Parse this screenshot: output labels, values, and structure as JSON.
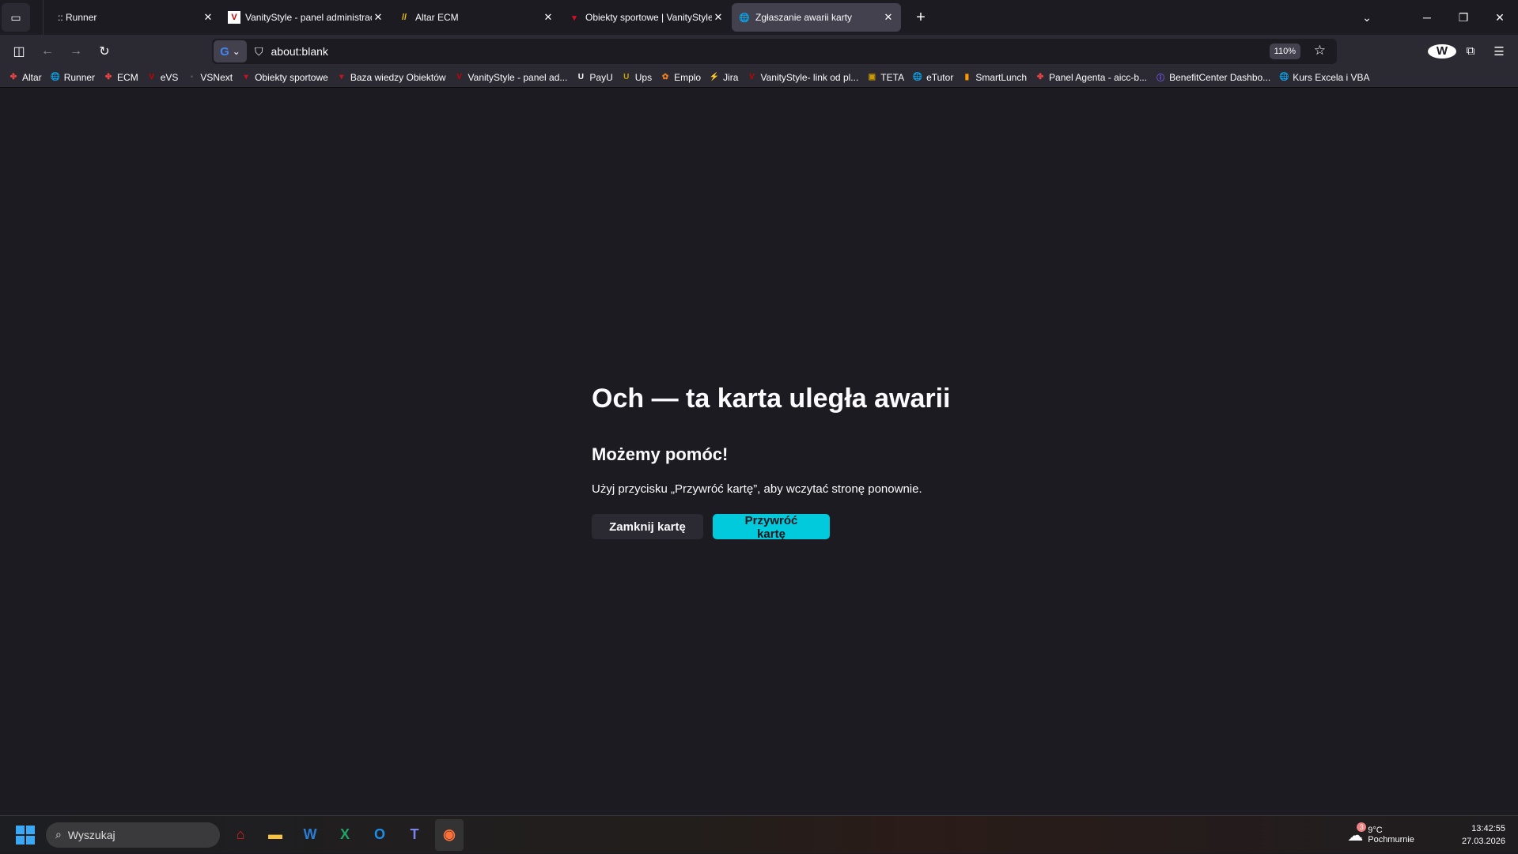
{
  "tabs": [
    {
      "title": ":: Runner",
      "icon": "none"
    },
    {
      "title": "VanityStyle - panel administracyjny",
      "icon": "vs-icon"
    },
    {
      "title": "Altar ECM",
      "icon": "altar-icon"
    },
    {
      "title": "Obiekty sportowe | VanityStyle.pl",
      "icon": "vanity-v-icon"
    },
    {
      "title": "Zgłaszanie awarii karty",
      "icon": "globe-alert-icon",
      "active": true
    }
  ],
  "url": "about:blank",
  "zoom": "110%",
  "bookmarks": [
    "Altar",
    "Runner",
    "ECM",
    "eVS",
    "VSNext",
    "Obiekty sportowe",
    "Baza wiedzy Obiektów",
    "VanityStyle - panel ad...",
    "PayU",
    "Ups",
    "Emplo",
    "Jira",
    "VanityStyle- link od pl...",
    "TETA",
    "eTutor",
    "SmartLunch",
    "Panel Agenta - aicc-b...",
    "BenefitCenter Dashbo...",
    "Kurs Excela i VBA"
  ],
  "page": {
    "heading": "Och — ta karta uległa awarii",
    "subheading": "Możemy pomóc!",
    "message": "Użyj przycisku „Przywróć kartę”, aby wczytać stronę ponownie.",
    "close_button": "Zamknij kartę",
    "restore_button": "Przywróć kartę"
  },
  "taskbar": {
    "search_placeholder": "Wyszukaj",
    "weather_temp": "9°C",
    "weather_desc": "Pochmurnie",
    "weather_badge": "3",
    "time": "13:42:55",
    "date": "27.03.2026"
  },
  "colors": {
    "accent": "#00cadb",
    "background": "#1c1b22"
  }
}
